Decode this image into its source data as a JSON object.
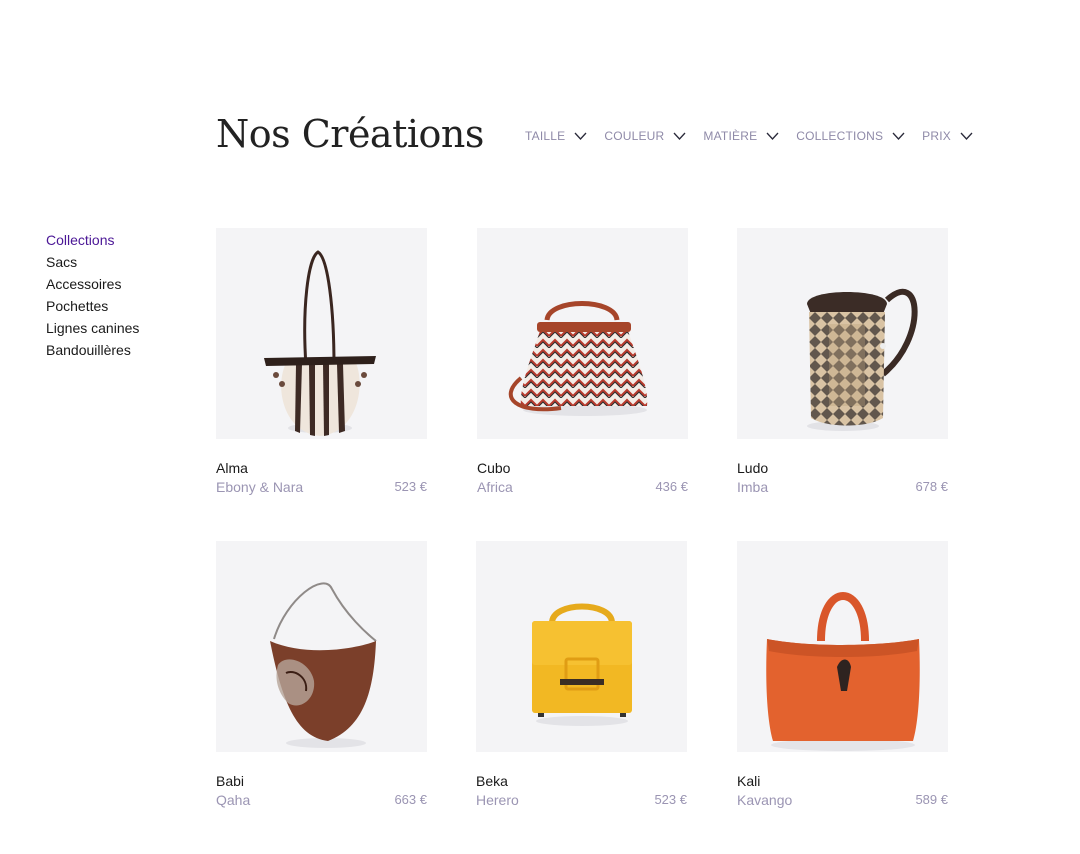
{
  "header": {
    "title": "Nos Créations"
  },
  "filters": [
    {
      "label": "TAILLE",
      "icon": "chevron-down-icon"
    },
    {
      "label": "COULEUR",
      "icon": "chevron-down-icon"
    },
    {
      "label": "MATIÈRE",
      "icon": "chevron-down-icon"
    },
    {
      "label": "COLLECTIONS",
      "icon": "chevron-down-icon"
    },
    {
      "label": "PRIX",
      "icon": "chevron-down-icon"
    }
  ],
  "sidebar": {
    "items": [
      {
        "label": "Collections",
        "active": true
      },
      {
        "label": "Sacs"
      },
      {
        "label": "Accessoires"
      },
      {
        "label": "Pochettes"
      },
      {
        "label": "Lignes canines"
      },
      {
        "label": "Bandouillères"
      }
    ]
  },
  "products": [
    {
      "name": "Alma",
      "collection": "Ebony & Nara",
      "price": "523 €",
      "image": "striped-bucket-bag"
    },
    {
      "name": "Cubo",
      "collection": "Africa",
      "price": "436 €",
      "image": "patterned-handbag"
    },
    {
      "name": "Ludo",
      "collection": "Imba",
      "price": "678 €",
      "image": "woven-backpack"
    },
    {
      "name": "Babi",
      "collection": "Qaha",
      "price": "663 €",
      "image": "brown-hobo-bag"
    },
    {
      "name": "Beka",
      "collection": "Herero",
      "price": "523 €",
      "image": "yellow-box-bag"
    },
    {
      "name": "Kali",
      "collection": "Kavango",
      "price": "589 €",
      "image": "orange-tote-bag"
    }
  ],
  "colors": {
    "accent": "#4b1796",
    "muted": "#9b95b3",
    "filter": "#8f8aa8",
    "tile": "#f4f4f6"
  }
}
